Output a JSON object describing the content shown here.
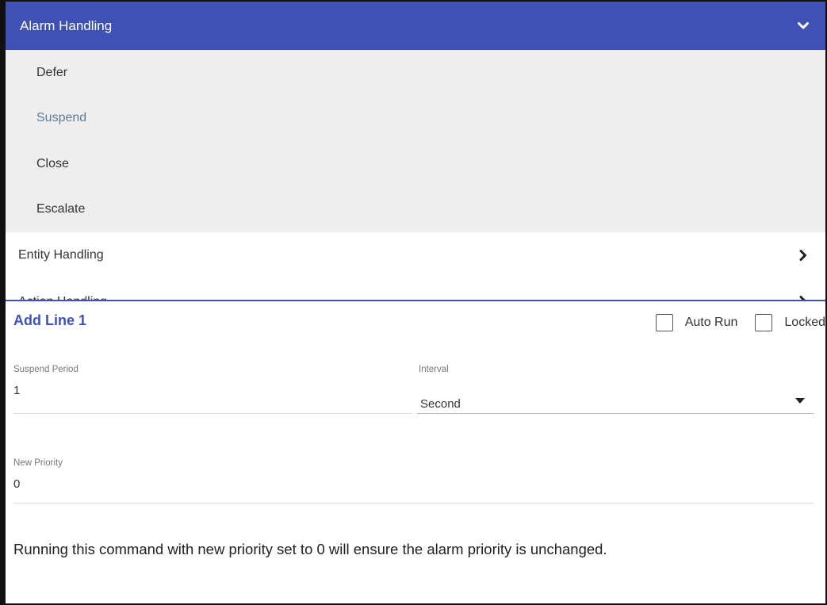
{
  "menu": {
    "header": {
      "title": "Alarm Handling",
      "icon": "chevron-down-icon"
    },
    "alarm_items": [
      {
        "label": "Defer"
      },
      {
        "label": "Suspend",
        "active": true
      },
      {
        "label": "Close"
      },
      {
        "label": "Escalate"
      }
    ],
    "sections": [
      {
        "label": "Entity Handling",
        "icon": "chevron-right-icon"
      },
      {
        "label": "Action Handling",
        "icon": "chevron-right-icon"
      }
    ],
    "colors": {
      "header_bg": "#3f51b5",
      "submenu_bg": "#eeeeee",
      "active_item": "#5e7d91"
    }
  },
  "form": {
    "title": "Add Line 1",
    "auto_run_label": "Auto Run",
    "locked_label": "Locked",
    "auto_run_checked": false,
    "locked_checked": false,
    "suspend_period": {
      "label": "Suspend Period",
      "value": "1"
    },
    "interval": {
      "label": "Interval",
      "value": "Second",
      "icon": "dropdown-arrow-icon"
    },
    "new_priority": {
      "label": "New Priority",
      "value": "0"
    },
    "help_text": "Running this command with new priority set to 0 will ensure the alarm priority is unchanged."
  }
}
